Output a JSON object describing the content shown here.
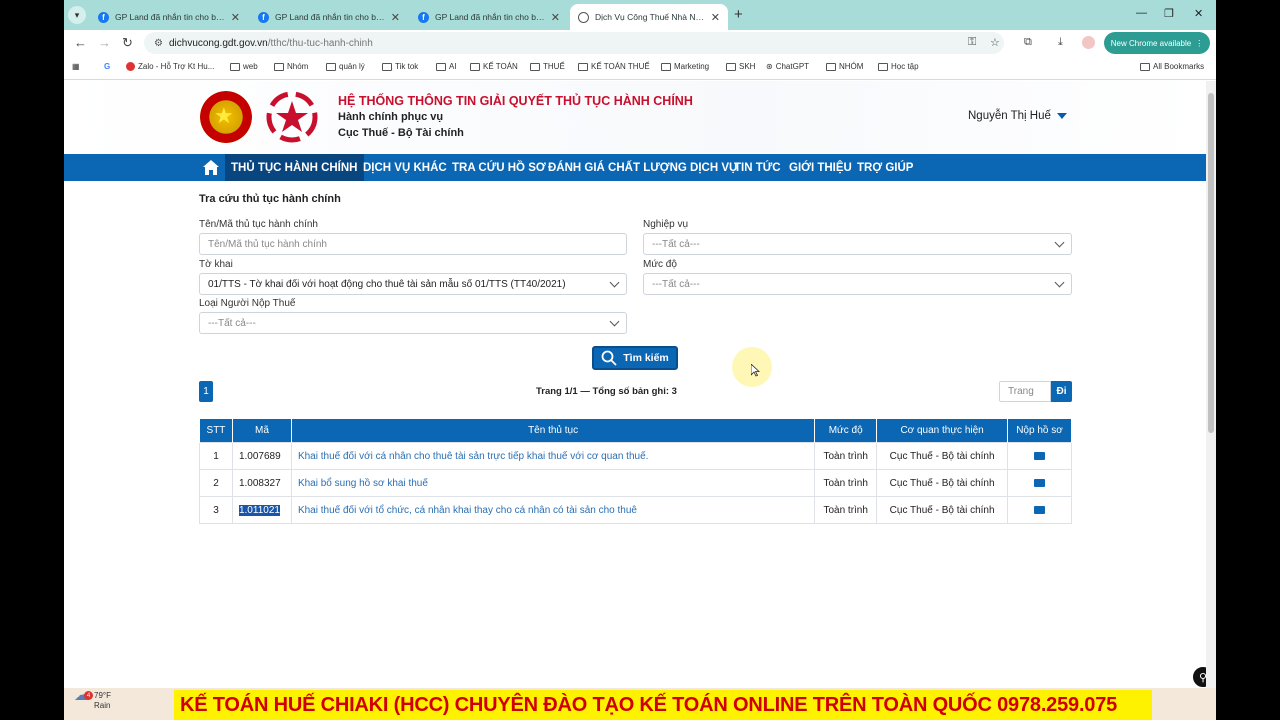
{
  "browser": {
    "tabs": [
      {
        "title": "GP Land đã nhắn tin cho bạn",
        "icon": "facebook-icon",
        "active": false
      },
      {
        "title": "GP Land đã nhắn tin cho bạn",
        "icon": "facebook-icon",
        "active": false
      },
      {
        "title": "GP Land đã nhắn tin cho bạn",
        "icon": "facebook-icon",
        "active": false
      },
      {
        "title": "Dịch Vụ Công Thuế Nhà Nước",
        "icon": "globe-icon",
        "active": true
      }
    ],
    "new_tab": "+",
    "url_domain": "dichvucong.gdt.gov.vn",
    "url_path": "/tthc/thu-tuc-hanh-chinh",
    "new_chrome": "New Chrome available",
    "bookmarks": [
      "Zalo - Hỗ Trợ Kt Hu...",
      "web",
      "Nhóm",
      "quản lý",
      "Tik tok",
      "AI",
      "KẾ TOÁN",
      "THUẾ",
      "KẾ TOÁN THUẾ",
      "Marketing",
      "SKH",
      "ChatGPT",
      "NHÓM",
      "Học tập"
    ],
    "all_bookmarks": "All Bookmarks"
  },
  "header": {
    "title": "HỆ THỐNG THÔNG TIN GIẢI QUYẾT THỦ TỤC HÀNH CHÍNH",
    "line2": "Hành chính phục vụ",
    "line3": "Cục Thuế - Bộ Tài chính",
    "user": "Nguyễn Thị Huế"
  },
  "menu": [
    "THỦ TỤC HÀNH CHÍNH",
    "DỊCH VỤ KHÁC",
    "TRA CỨU HỒ SƠ",
    "ĐÁNH GIÁ CHẤT LƯỢNG DỊCH VỤ",
    "TIN TỨC",
    "GIỚI THIỆU",
    "TRỢ GIÚP"
  ],
  "form": {
    "heading": "Tra cứu thủ tục hành chính",
    "name_label": "Tên/Mã thủ tục hành chính",
    "name_placeholder": "Tên/Mã thủ tục hành chính",
    "nghiepvu_label": "Nghiệp vụ",
    "nghiepvu_value": "---Tất cả---",
    "tokhai_label": "Tờ khai",
    "tokhai_value": "01/TTS - Tờ khai đối với hoạt động cho thuê tài sản mẫu số 01/TTS (TT40/2021)",
    "mucdo_label": "Mức độ",
    "mucdo_value": "---Tất cả---",
    "loai_label": "Loại Người Nộp Thuế",
    "loai_value": "---Tất cả---",
    "search_label": "Tìm kiếm"
  },
  "pagination": {
    "current": "1",
    "info": "Trang 1/1 — Tổng số bản ghi: 3",
    "page_placeholder": "Trang",
    "go": "Đi"
  },
  "table": {
    "headers": [
      "STT",
      "Mã",
      "Tên thủ tục",
      "Mức độ",
      "Cơ quan thực hiện",
      "Nộp hồ sơ"
    ],
    "rows": [
      {
        "stt": "1",
        "ma": "1.007689",
        "ten": "Khai thuế đối với cá nhân cho thuê tài sản trực tiếp khai thuế với cơ quan thuế.",
        "mucdo": "Toàn trình",
        "coquan": "Cục Thuế - Bộ tài chính"
      },
      {
        "stt": "2",
        "ma": "1.008327",
        "ten": "Khai bổ sung hồ sơ khai thuế",
        "mucdo": "Toàn trình",
        "coquan": "Cục Thuế - Bộ tài chính"
      },
      {
        "stt": "3",
        "ma": "1.011021",
        "ten": "Khai thuế đối với tổ chức, cá nhân khai thay cho cá nhân có tài sản cho thuê",
        "mucdo": "Toàn trình",
        "coquan": "Cục Thuế - Bộ tài chính"
      }
    ]
  },
  "taskbar": {
    "weather_badge": "4",
    "temp": "79°F",
    "condition": "Rain"
  },
  "banner": "KẾ TOÁN HUẾ CHIAKI (HCC) CHUYÊN ĐÀO TẠO KẾ TOÁN ONLINE TRÊN TOÀN QUỐC 0978.259.075"
}
